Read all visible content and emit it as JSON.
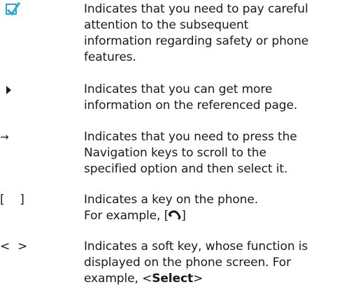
{
  "entries": [
    {
      "symbol_icon": "checkbox-checked-icon",
      "symbol_color": "#2aa9d8",
      "lines": [
        "Indicates that you need to pay careful",
        "attention to the subsequent",
        "information regarding safety or phone",
        "features."
      ]
    },
    {
      "symbol_icon": "triangle-right-icon",
      "lines": [
        "Indicates that you can get more",
        "information on the referenced page."
      ]
    },
    {
      "symbol": "→",
      "lines": [
        "Indicates that you need to press the",
        "Navigation keys to scroll to the",
        "specified option and then select it."
      ]
    },
    {
      "symbol": "[    ]",
      "lines": [
        "Indicates a key on the phone."
      ],
      "example_prefix": "For example, [",
      "example_icon": "end-call-key-icon",
      "example_suffix": "]"
    },
    {
      "symbol": "<  >",
      "lines": [
        "Indicates a soft key, whose function is",
        "displayed on the phone screen. For"
      ],
      "example_prefix": "example, <",
      "example_bold": "Select",
      "example_suffix": ">"
    }
  ]
}
